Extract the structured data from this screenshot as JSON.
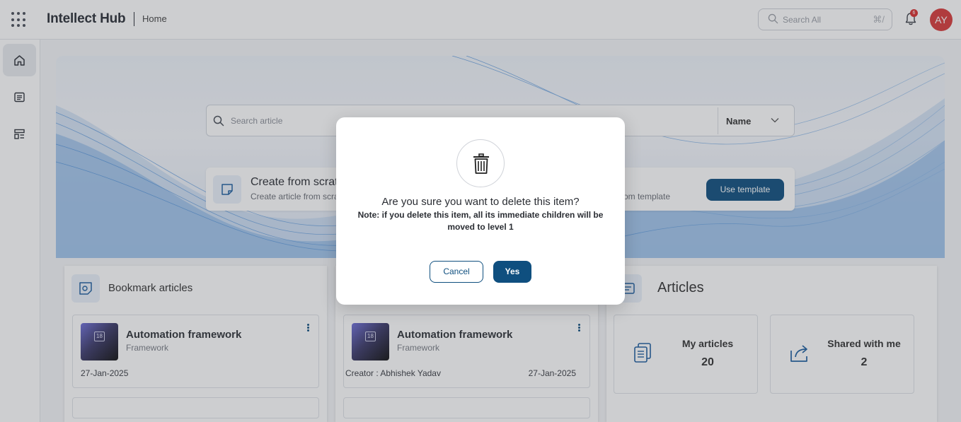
{
  "header": {
    "app_title": "Intellect Hub",
    "breadcrumb": "Home",
    "search_placeholder": "Search All",
    "search_shortcut": "⌘/",
    "notification_count": "6",
    "avatar_initials": "AY"
  },
  "sidebar": {
    "items": [
      {
        "icon": "home-icon",
        "active": true
      },
      {
        "icon": "article-list-icon",
        "active": false
      },
      {
        "icon": "template-icon",
        "active": false
      }
    ]
  },
  "hero": {
    "search_placeholder": "Search article",
    "sort_selected": "Name",
    "create_title": "Create from scratch",
    "create_subtitle": "Create article from scratch",
    "template_subtitle": "Create article from template",
    "use_template_label": "Use template"
  },
  "bookmarks": {
    "title": "Bookmark articles",
    "items": [
      {
        "name": "Automation framework",
        "category": "Framework",
        "date": "27-Jan-2025",
        "thumb_badge": "18"
      }
    ]
  },
  "recent": {
    "items": [
      {
        "name": "Automation framework",
        "category": "Framework",
        "creator": "Creator : Abhishek Yadav",
        "date": "27-Jan-2025",
        "thumb_badge": "18"
      }
    ]
  },
  "articles": {
    "title": "Articles",
    "my_articles_label": "My articles",
    "my_articles_count": "20",
    "shared_label": "Shared with me",
    "shared_count": "2"
  },
  "dialog": {
    "question": "Are you sure you want to delete this item?",
    "note": "Note: if you delete this item, all its immediate children will be moved to level 1",
    "cancel_label": "Cancel",
    "confirm_label": "Yes"
  },
  "colors": {
    "primary": "#0f4f7f",
    "avatar": "#d83a3a",
    "badge": "#d93030"
  }
}
